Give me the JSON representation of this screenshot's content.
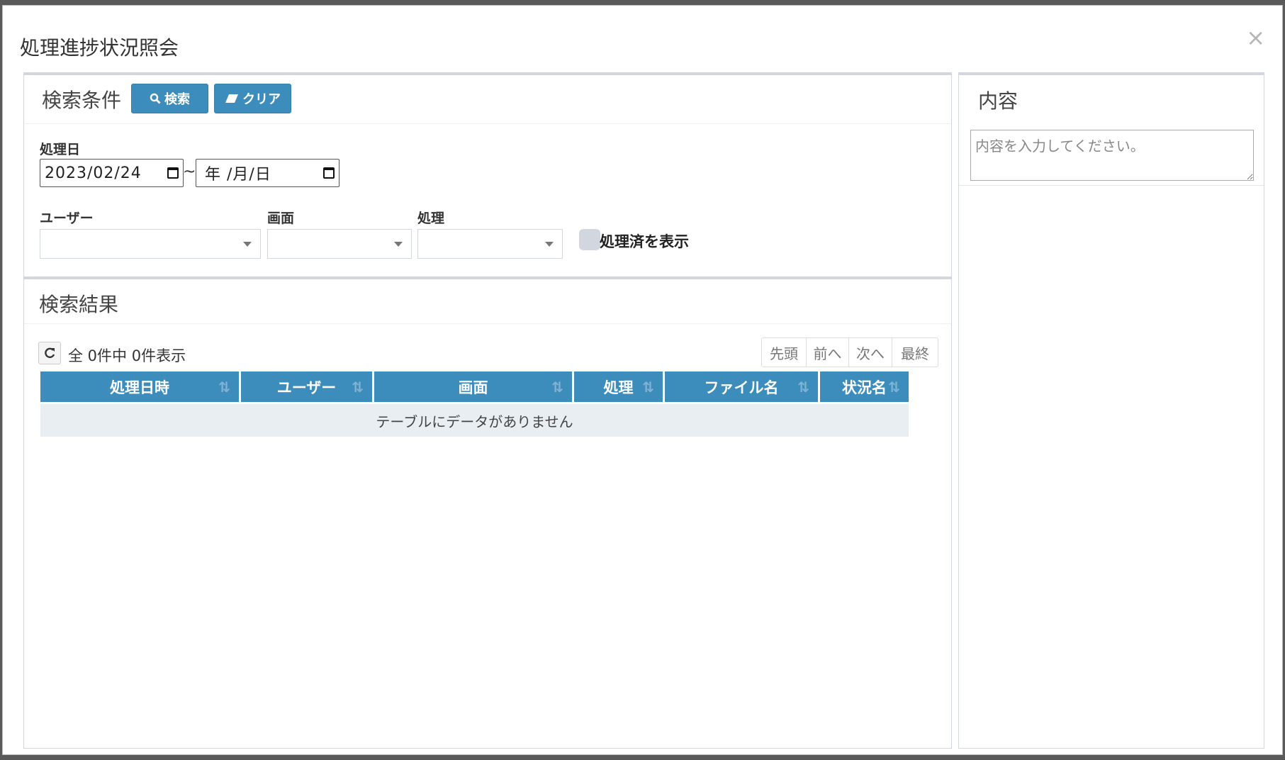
{
  "modal": {
    "title": "処理進捗状況照会",
    "close": "×"
  },
  "search": {
    "title": "検索条件",
    "search_button": "検索",
    "clear_button": "クリア",
    "date_label": "処理日",
    "date_from": "2023/02/24",
    "date_sep": "~",
    "date_to_placeholder": "年 /月/日",
    "user_label": "ユーザー",
    "screen_label": "画面",
    "process_label": "処理",
    "show_processed_label": "処理済を表示"
  },
  "results": {
    "title": "検索結果",
    "count_text": "全 0件中 0件表示",
    "pager": [
      "先頭",
      "前へ",
      "次へ",
      "最終"
    ],
    "columns": [
      "処理日時",
      "ユーザー",
      "画面",
      "処理",
      "ファイル名",
      "状況名"
    ],
    "empty_text": "テーブルにデータがありません"
  },
  "content": {
    "title": "内容",
    "placeholder": "内容を入力してください。"
  },
  "colors": {
    "primary": "#3c8dbc",
    "empty_row": "#e9eef2"
  },
  "icons": {
    "search": "search-icon",
    "clear": "eraser-icon",
    "refresh": "refresh-icon",
    "sort": "sort-icon"
  }
}
